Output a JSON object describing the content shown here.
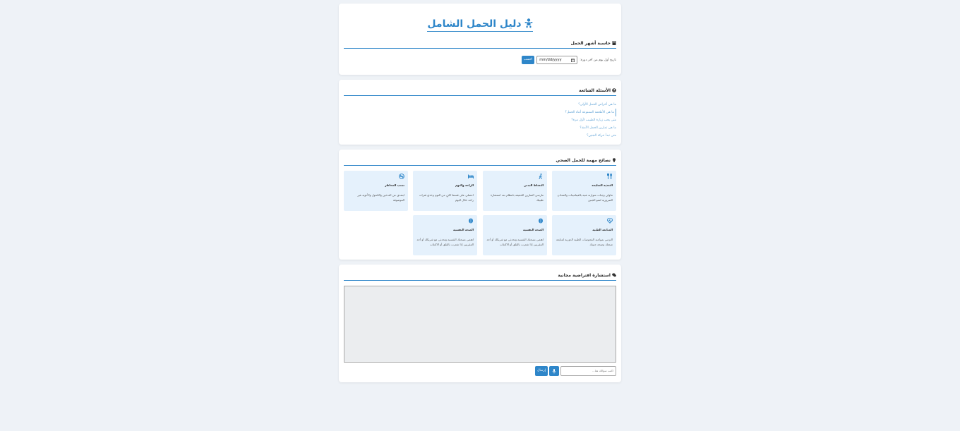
{
  "header": {
    "title": "دليل الحمل الشامل",
    "icon": "baby-icon"
  },
  "calculator": {
    "title": "حاسبة أشهر الحمل",
    "icon": "calculator-icon",
    "date_label": "تاريخ أول يوم من آخر دورة:",
    "date_placeholder": "mm/dd/yyyy",
    "calc_button": "احسب"
  },
  "faq": {
    "title": "الأسئلة الشائعة",
    "icon": "question-circle-icon",
    "items": [
      "ما هي أعراض الحمل الأولى؟",
      "ما هي الأطعمة الممنوعة أثناء الحمل؟",
      "متى يجب زيارة الطبيب لأول مرة؟",
      "ما هي تمارين الحمل الآمنة؟",
      "متى تبدأ حركة الجنين؟"
    ]
  },
  "tips": {
    "title": "نصائح مهمة للحمل الصحي",
    "icon": "lightbulb-icon",
    "items": [
      {
        "icon": "utensils-icon",
        "title": "التغذية السليمة",
        "desc": "تناولي وجبات متوازنة غنية بالفيتامينات والمعادن الضرورية لنمو الجنين"
      },
      {
        "icon": "walking-icon",
        "title": "النشاط البدني",
        "desc": "مارسي التمارين الخفيفة بانتظام بعد استشارة طبيبك"
      },
      {
        "icon": "bed-icon",
        "title": "الراحة والنوم",
        "desc": "احصلي على قسط كافٍ من النوم وخذي فترات راحة خلال اليوم"
      },
      {
        "icon": "no-smoking-icon",
        "title": "تجنب المخاطر",
        "desc": "ابتعدي عن التدخين والكحول والأدوية غير الموصوفة"
      },
      {
        "icon": "heartbeat-icon",
        "title": "المتابعة الطبية",
        "desc": "التزمي بمواعيد الفحوصات الطبية الدورية لمتابعة صحتك وصحة جنينك"
      },
      {
        "icon": "brain-icon",
        "title": "الصحة النفسية",
        "desc": "اهتمي بصحتك النفسية وتحدثي مع شريكك أو أحد المقربين إذا شعرت بالقلق أو الاكتئاب"
      },
      {
        "icon": "brain-icon",
        "title": "الصحة النفسية",
        "desc": "اهتمي بصحتك النفسية وتحدثي مع شريكك أو أحد المقربين إذا شعرت بالقلق أو الاكتئاب"
      }
    ]
  },
  "chat": {
    "title": "استشارة افتراضية مجانية",
    "icon": "comments-icon",
    "input_placeholder": "اكتب سؤالك هنا...",
    "mic_icon": "microphone-icon",
    "send_button": "إرسال"
  }
}
